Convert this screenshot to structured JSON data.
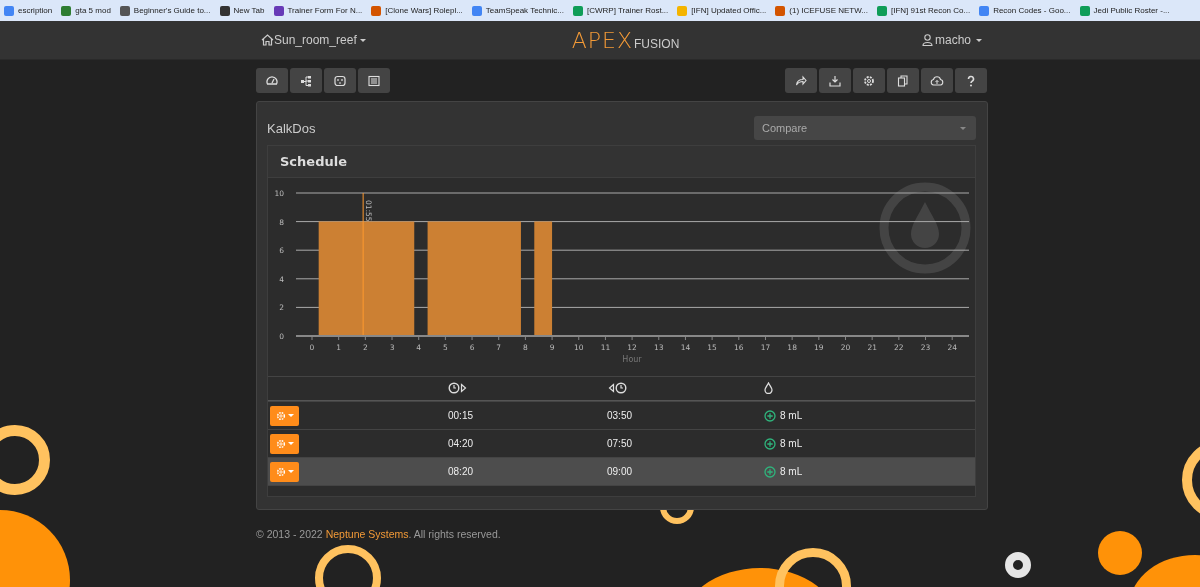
{
  "bookmarks": [
    {
      "label": "escription",
      "kind": "doc"
    },
    {
      "label": "gta 5 mod",
      "kind": "game"
    },
    {
      "label": "Beginner's Guide to...",
      "kind": "misc"
    },
    {
      "label": "New Tab",
      "kind": "globe"
    },
    {
      "label": "Trainer Form For N...",
      "kind": "form"
    },
    {
      "label": "[Clone Wars] Rolepl...",
      "kind": "flame"
    },
    {
      "label": "TeamSpeak Technic...",
      "kind": "doc"
    },
    {
      "label": "[CWRP] Trainer Rost...",
      "kind": "sheet"
    },
    {
      "label": "[IFN] Updated Offic...",
      "kind": "slides"
    },
    {
      "label": "(1) ICEFUSE NETW...",
      "kind": "flame"
    },
    {
      "label": "[IFN] 91st Recon Co...",
      "kind": "sheet"
    },
    {
      "label": "Recon Codes - Goo...",
      "kind": "doc"
    },
    {
      "label": "Jedi Public Roster -...",
      "kind": "sheet"
    }
  ],
  "navbar": {
    "location": "Sun_room_reef",
    "logo": "APEX",
    "logo_suffix": "FUSION",
    "user": "macho"
  },
  "panel": {
    "title": "KalkDos",
    "compare": {
      "placeholder": "Compare"
    },
    "card_title": "Schedule",
    "chart_data": {
      "type": "area",
      "xlabel": "Hour",
      "x": [
        0,
        0.25,
        0.25,
        3.833,
        3.833,
        4.333,
        4.333,
        7.833,
        7.833,
        8.333,
        8.333,
        9,
        9,
        24
      ],
      "series": [
        {
          "color": "#cc8033",
          "values": [
            0,
            0,
            8,
            8,
            0,
            0,
            8,
            8,
            0,
            0,
            8,
            8,
            0,
            0
          ]
        }
      ],
      "xlim": [
        -0.6,
        24.63
      ],
      "ylim": [
        0,
        10
      ],
      "grid": true,
      "xticks": [
        0,
        1,
        2,
        3,
        4,
        5,
        6,
        7,
        8,
        9,
        10,
        11,
        12,
        13,
        14,
        15,
        16,
        17,
        18,
        19,
        20,
        21,
        22,
        23,
        24
      ],
      "yticks": [
        0,
        2,
        4,
        6,
        8,
        10
      ],
      "ref_lines": [
        {
          "axis": "x",
          "value": 1.917,
          "color": "#ff9a2e"
        }
      ]
    },
    "cursor_time": "01:55",
    "rows": [
      {
        "start": "00:15",
        "end": "03:50",
        "amount": "8 mL",
        "selected": false
      },
      {
        "start": "04:20",
        "end": "07:50",
        "amount": "8 mL",
        "selected": false
      },
      {
        "start": "08:20",
        "end": "09:00",
        "amount": "8 mL",
        "selected": true
      }
    ]
  },
  "footer": {
    "prefix": "© 2013 - 2022 ",
    "link": "Neptune Systems",
    "suffix": ". All rights reserved."
  }
}
